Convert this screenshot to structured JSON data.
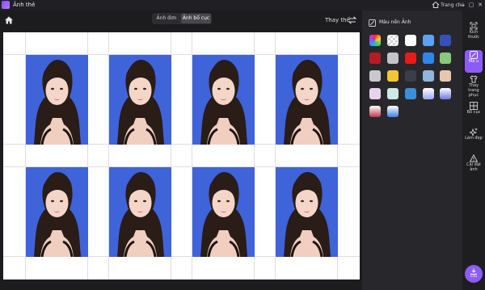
{
  "app": {
    "title": "Ảnh thẻ"
  },
  "titlebar": {
    "home_label": "Trang chủ",
    "minimize": "—",
    "maximize": "▢",
    "close": "✕"
  },
  "toolbar": {
    "tab_single": "Ảnh đơn",
    "tab_layout": "Ảnh bố cục",
    "replace_label": "Thay thế"
  },
  "panel": {
    "title": "Màu nền Ảnh",
    "swatches": [
      "rainbow",
      "transparent",
      "#ffffff",
      "#5ea2f5",
      "#3551b8",
      "#b71c25",
      "#c4c4c6",
      "#e81b1b",
      "#2f86ea",
      "#8bc97a",
      "#c9c9cb",
      "#f3c635",
      "#3b3e48",
      "#8fb5e0",
      "#e8c7b2",
      "#e7d3ec",
      "#cde9e1",
      "#3a8fd8",
      "#9aa6f2",
      "#6b7be0",
      "#c0394a",
      "#3f7fe6"
    ]
  },
  "rail": {
    "items": [
      {
        "label": "Kích thước"
      },
      {
        "label": "Mà u",
        "active": true
      },
      {
        "label": "Thay trang phục"
      },
      {
        "label": "Bố cục"
      },
      {
        "label": "Làm đẹp"
      },
      {
        "label": "Cài đặt ảnh"
      }
    ],
    "save_label": "Lưu"
  },
  "colors": {
    "accent": "#8b5cf6",
    "photo_bg": "#3f63d9"
  }
}
